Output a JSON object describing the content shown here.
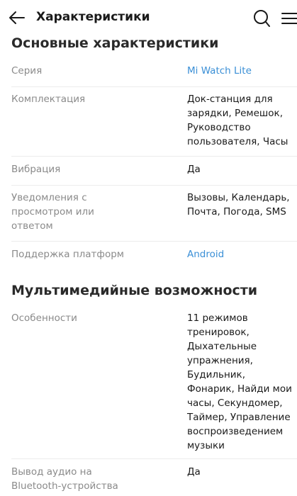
{
  "header": {
    "title": "Характеристики",
    "back_icon": "arrow-left-icon",
    "search_icon": "search-icon",
    "menu_icon": "hamburger-menu-icon"
  },
  "sections": [
    {
      "title": "Основные характеристики",
      "rows": [
        {
          "label": "Серия",
          "value": "Mi Watch Lite",
          "link": true
        },
        {
          "label": "Комплектация",
          "value": "Док-станция для зарядки, Ремешок, Руководство пользователя, Часы",
          "link": false
        },
        {
          "label": "Вибрация",
          "value": "Да",
          "link": false
        },
        {
          "label": "Уведомления с просмотром или ответом",
          "value": "Вызовы, Календарь, Почта, Погода, SMS",
          "link": false
        },
        {
          "label": "Поддержка платформ",
          "value": "Android",
          "link": true
        }
      ]
    },
    {
      "title": "Мультимедийные возможности",
      "rows": [
        {
          "label": "Особенности",
          "value": "11 режимов тренировок, Дыхательные упражнения, Будильник, Фонарик, Найди мои часы, Секундомер, Таймер, Управление воспроизведением музыки",
          "link": false
        },
        {
          "label": "Вывод аудио на Bluetooth-устройства",
          "value": "Да",
          "link": false
        }
      ]
    }
  ],
  "colors": {
    "link": "#3a8fd6",
    "label": "#8a8a8a",
    "text": "#1a1a1a",
    "divider": "#ececec"
  }
}
